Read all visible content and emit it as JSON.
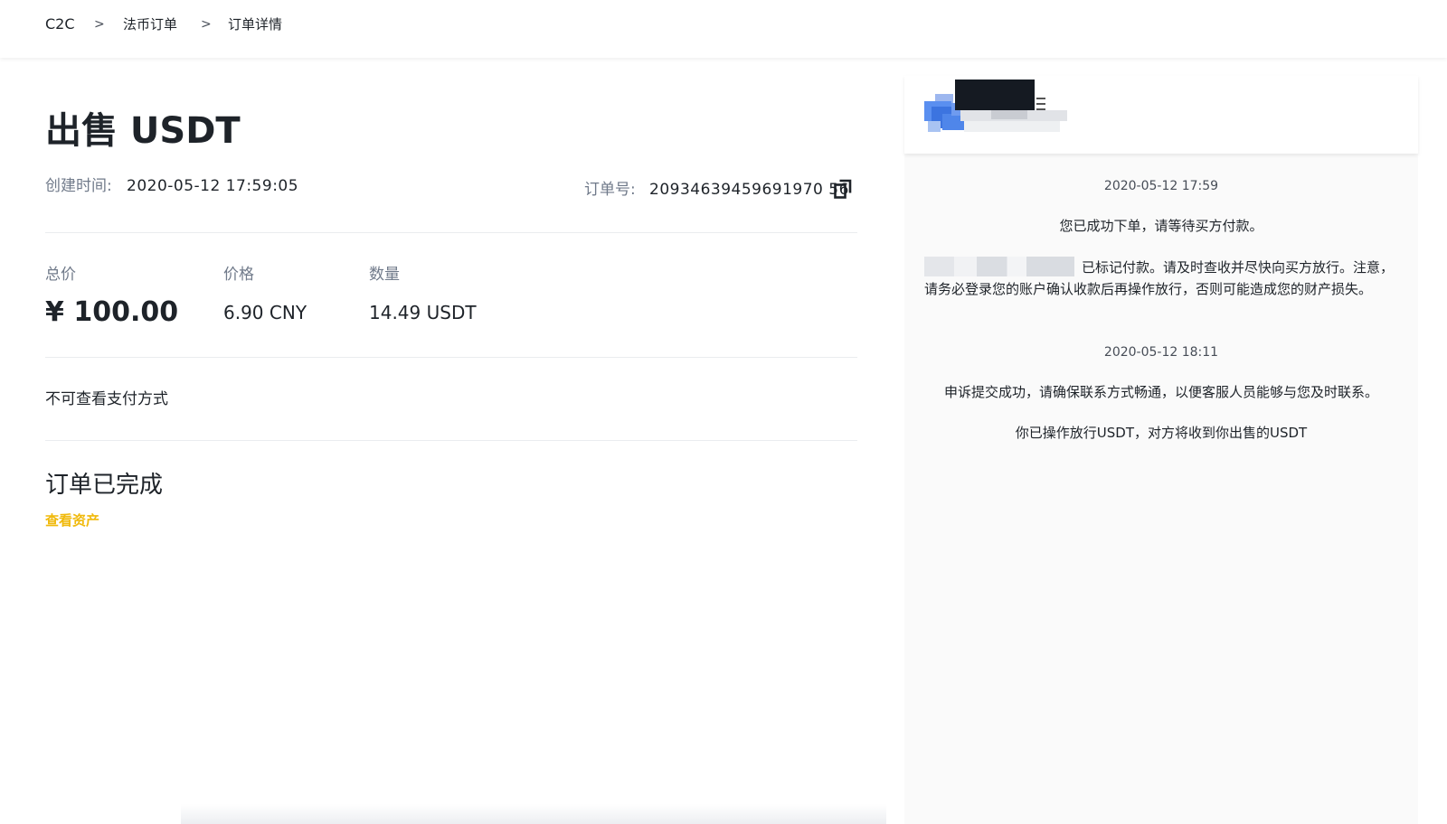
{
  "breadcrumb": {
    "items": [
      "C2C",
      "法币订单",
      "订单详情"
    ],
    "separator": ">"
  },
  "order": {
    "title": "出售 USDT",
    "created_label": "创建时间:",
    "created_value": "2020-05-12 17:59:05",
    "order_no_label": "订单号:",
    "order_no_value": "20934639459691970 56",
    "total_label": "总价",
    "total_value": "¥ 100.00",
    "price_label": "价格",
    "price_value": "6.90 CNY",
    "quantity_label": "数量",
    "quantity_value": "14.49 USDT",
    "payment_method_text": "不可查看支付方式",
    "status_text": "订单已完成",
    "view_assets_label": "查看资产"
  },
  "chat": {
    "messages": [
      {
        "time": "2020-05-12 17:59"
      },
      {
        "text": "您已成功下单，请等待买方付款。"
      },
      {
        "text": "已标记付款。请及时查收并尽快向买方放行。注意，请务必登录您的账户确认收款后再操作放行，否则可能造成您的财产损失。"
      },
      {
        "time": "2020-05-12 18:11"
      },
      {
        "text": "申诉提交成功，请确保联系方式畅通，以便客服人员能够与您及时联系。"
      },
      {
        "text": "你已操作放行USDT，对方将收到你出售的USDT"
      }
    ]
  },
  "colors": {
    "accent": "#f0b90b",
    "text_primary": "#1e2329",
    "text_secondary": "#707a8a",
    "divider": "#eaecef",
    "chat_bg": "#fafafa"
  },
  "icons": {
    "copy": "copy-icon",
    "avatar": "user-avatar"
  }
}
